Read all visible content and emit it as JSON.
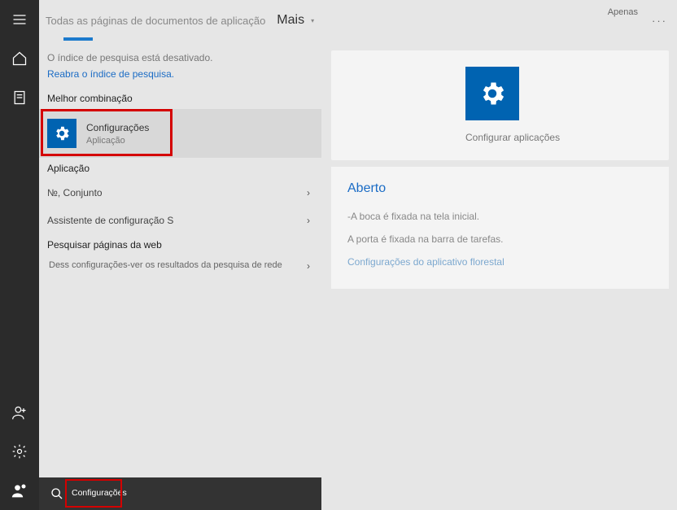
{
  "tabs": {
    "label": "Todas as páginas de documentos de aplicação",
    "more": "Mais",
    "apenas": "Ape­nas"
  },
  "info": {
    "disabled": "O índice de pesquisa está desativado.",
    "link": "Reabra o índice de pesquisa."
  },
  "sections": {
    "best": "Melhor combinação",
    "app": "Aplicação",
    "web": "Pesquisar páginas da web"
  },
  "bestMatch": {
    "title": "Configurações",
    "subtitle": "Aplicação"
  },
  "apps": {
    "a1": "№, Conjunto",
    "a2": "Assistente de configuração S"
  },
  "web": {
    "w1": "Dess configurações-ver os resultados da pesquisa de rede"
  },
  "right": {
    "appName": "Configu­rar apli­cações",
    "aberto": "Aberto",
    "l1": "-A boca é fixada na tela inicial.",
    "l2": "A porta é fixada na barra de tarefas.",
    "l3": "Configurações do aplicativo florestal"
  },
  "search": {
    "text": "Configu­rações"
  }
}
